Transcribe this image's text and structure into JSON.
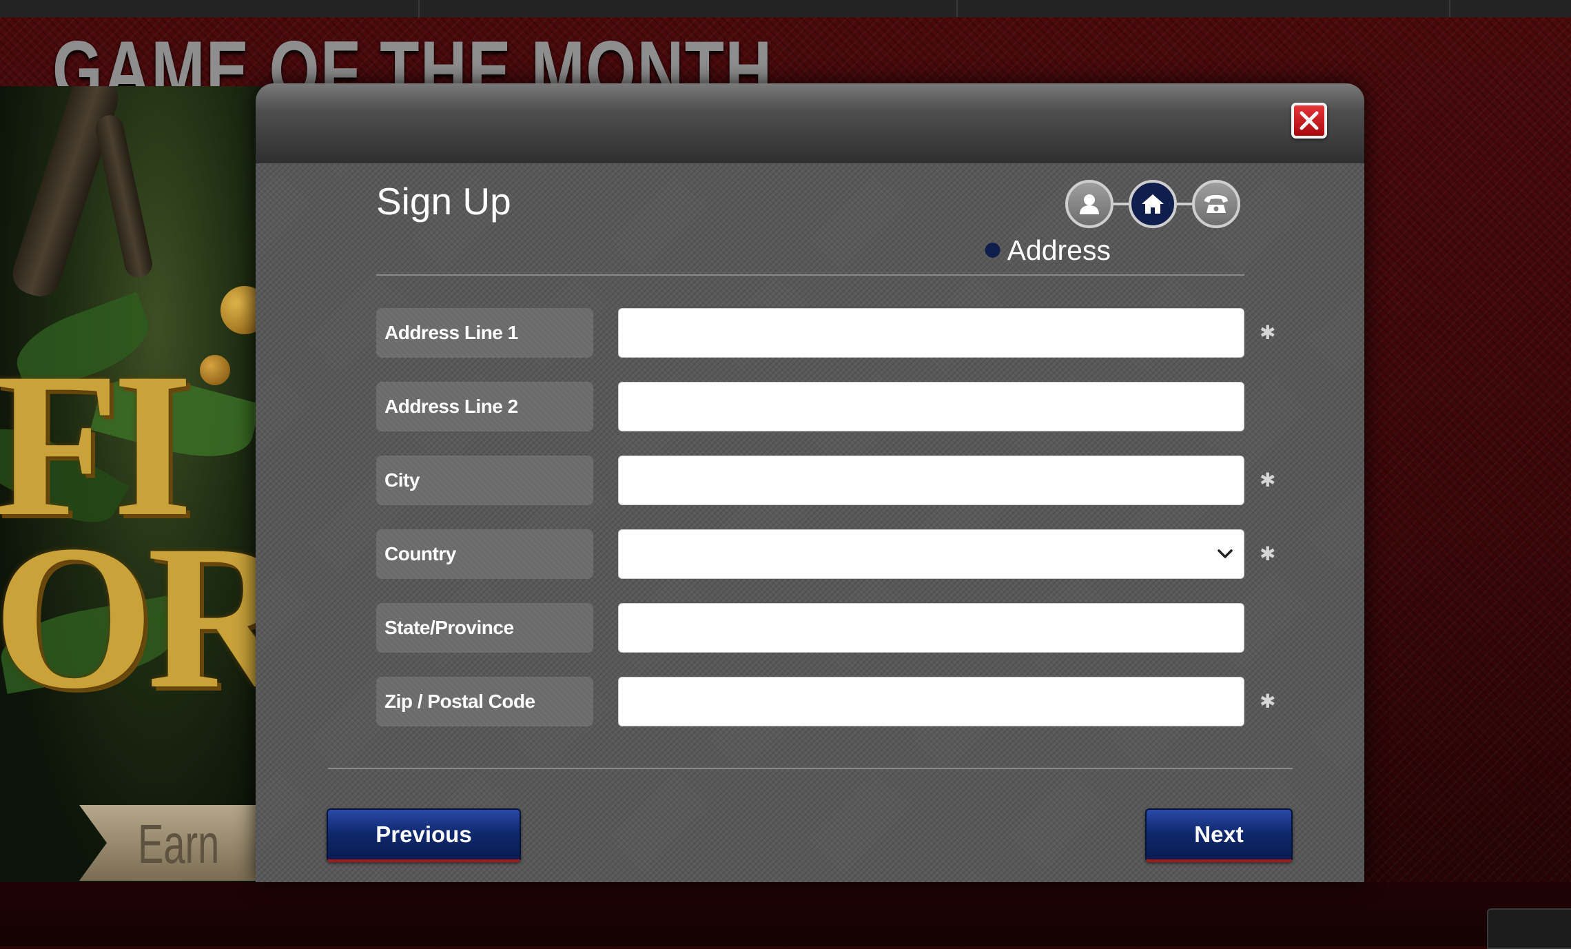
{
  "background": {
    "banner_title": "GAME OF THE MONTH",
    "game_letters": "FI\nOR",
    "earn_text": "Earn"
  },
  "modal": {
    "title": "Sign Up",
    "steps": [
      {
        "icon": "user-icon",
        "state": "done"
      },
      {
        "icon": "home-icon",
        "state": "current"
      },
      {
        "icon": "phone-icon",
        "state": "upcoming"
      }
    ],
    "current_step_label": "Address",
    "fields": [
      {
        "label": "Address Line 1",
        "value": "",
        "required": true
      },
      {
        "label": "Address Line 2",
        "value": "",
        "required": false
      },
      {
        "label": "City",
        "value": "",
        "required": true
      },
      {
        "label": "Country",
        "value": "",
        "required": true,
        "type": "select"
      },
      {
        "label": "State/Province",
        "value": "",
        "required": false
      },
      {
        "label": "Zip / Postal Code",
        "value": "",
        "required": true
      }
    ],
    "required_symbol": "✱",
    "previous_label": "Previous",
    "next_label": "Next"
  },
  "colors": {
    "accent_blue": "#0f1e4d",
    "button_blue": "#10296f",
    "close_red": "#d0161c",
    "backdrop_red": "#3b0709"
  }
}
